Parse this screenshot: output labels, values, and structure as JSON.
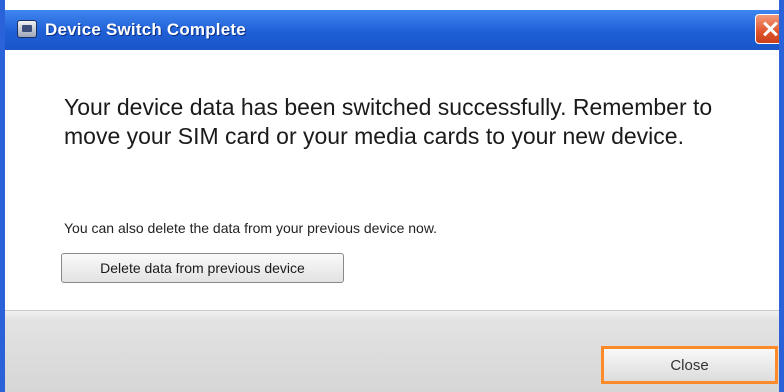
{
  "window": {
    "title": "Device Switch Complete",
    "title_icon": "device-icon",
    "close_icon": "close-icon",
    "colors": {
      "titlebar": "#1f5fd6",
      "close_button": "#e0542b",
      "focus_outline": "#ff8a2a"
    }
  },
  "main": {
    "message": "Your device data has been switched successfully. Remember to move your SIM card or your media cards to your new device.",
    "sub_text": "You can also delete the data from your previous device now.",
    "delete_button_label": "Delete data from previous device"
  },
  "footer": {
    "close_button_label": "Close"
  }
}
